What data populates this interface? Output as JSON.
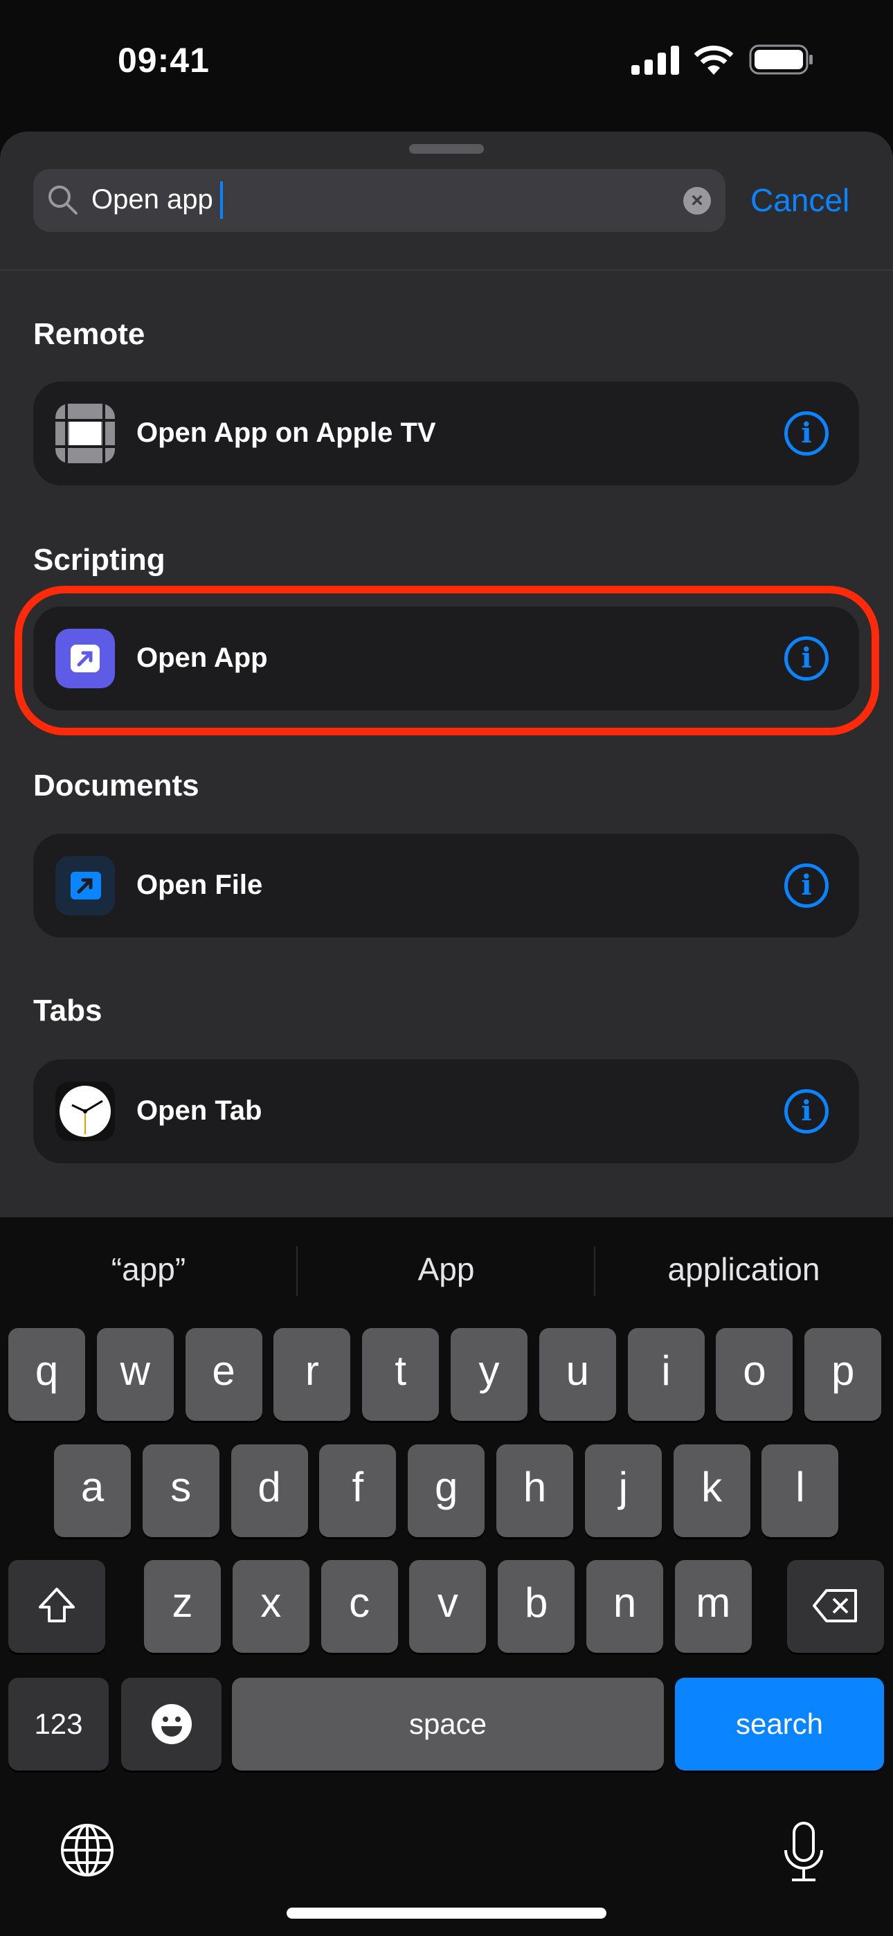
{
  "status_bar": {
    "time": "09:41",
    "icons": [
      "signal-icon",
      "wifi-icon",
      "battery-icon"
    ]
  },
  "search": {
    "value": "Open app",
    "cancel_label": "Cancel"
  },
  "sections": [
    {
      "header": "Remote",
      "item": {
        "label": "Open App on Apple TV",
        "icon": "apple-tv-remote-icon"
      }
    },
    {
      "header": "Scripting",
      "item": {
        "label": "Open App",
        "icon": "open-app-icon"
      }
    },
    {
      "header": "Documents",
      "item": {
        "label": "Open File",
        "icon": "open-file-icon"
      }
    },
    {
      "header": "Tabs",
      "item": {
        "label": "Open Tab",
        "icon": "clock-icon"
      }
    }
  ],
  "highlight_color": "#ff2a0a",
  "accent_color": "#0a84ff",
  "keyboard": {
    "suggestions": [
      "“app”",
      "App",
      "application"
    ],
    "row1": [
      "q",
      "w",
      "e",
      "r",
      "t",
      "y",
      "u",
      "i",
      "o",
      "p"
    ],
    "row2": [
      "a",
      "s",
      "d",
      "f",
      "g",
      "h",
      "j",
      "k",
      "l"
    ],
    "row3": [
      "z",
      "x",
      "c",
      "v",
      "b",
      "n",
      "m"
    ],
    "numbers_label": "123",
    "space_label": "space",
    "search_label": "search"
  }
}
